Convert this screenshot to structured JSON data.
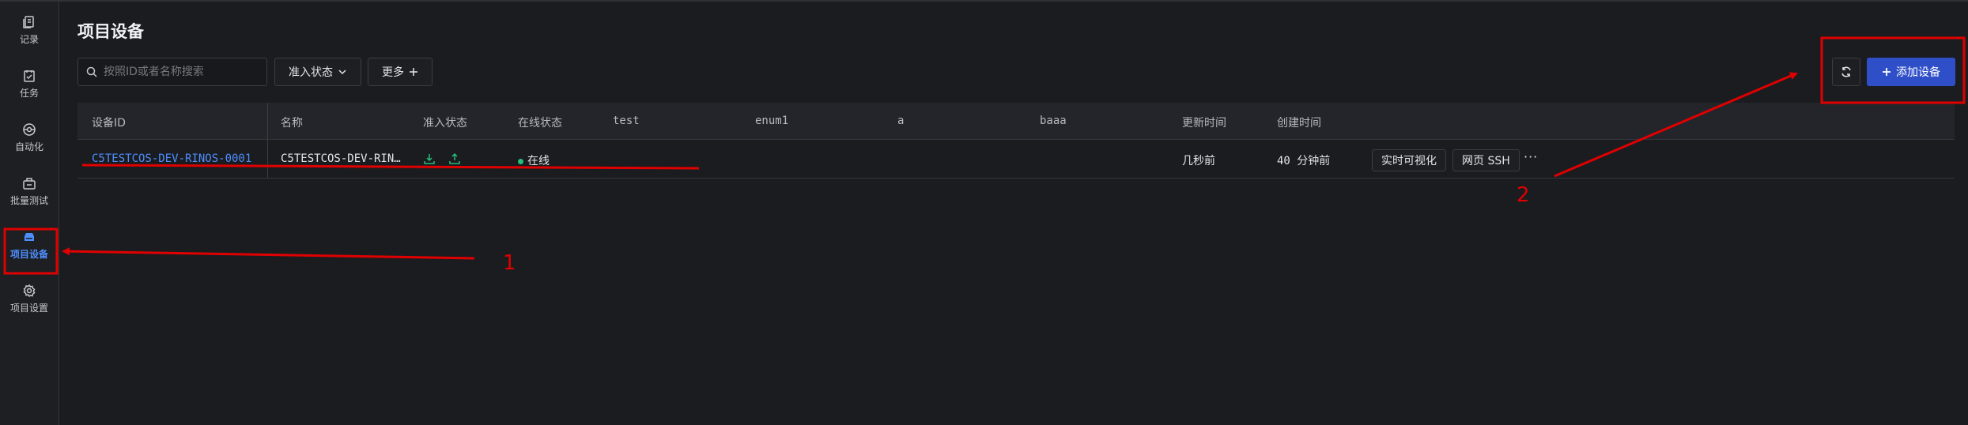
{
  "sidebar": {
    "items": [
      {
        "label": "记录",
        "icon": "records-icon"
      },
      {
        "label": "任务",
        "icon": "tasks-icon"
      },
      {
        "label": "自动化",
        "icon": "automation-icon"
      },
      {
        "label": "批量测试",
        "icon": "batch-test-icon"
      },
      {
        "label": "项目设备",
        "icon": "devices-icon",
        "active": true
      },
      {
        "label": "项目设置",
        "icon": "gear-icon"
      }
    ]
  },
  "page": {
    "title": "项目设备"
  },
  "toolbar": {
    "search_placeholder": "按照ID或者名称搜索",
    "filter_label": "准入状态",
    "more_label": "更多",
    "add_label": "添加设备"
  },
  "table": {
    "headers": [
      "设备ID",
      "名称",
      "准入状态",
      "在线状态",
      "test",
      "enum1",
      "a",
      "baaa",
      "更新时间",
      "创建时间"
    ],
    "rows": [
      {
        "device_id": "C5TESTCOS-DEV-RINOS-0001",
        "name": "C5TESTCOS-DEV-RIN…",
        "online_status": "在线",
        "updated": "几秒前",
        "created": "40 分钟前",
        "action_visualize": "实时可视化",
        "action_ssh": "网页 SSH",
        "action_more": "···"
      }
    ]
  },
  "annotations": {
    "label1": "1",
    "label2": "2",
    "color": "#e00000"
  },
  "colors": {
    "accent": "#4d8eff",
    "primary_button": "#2f4fc9",
    "online": "#22c07a",
    "background": "#1b1c1f"
  }
}
